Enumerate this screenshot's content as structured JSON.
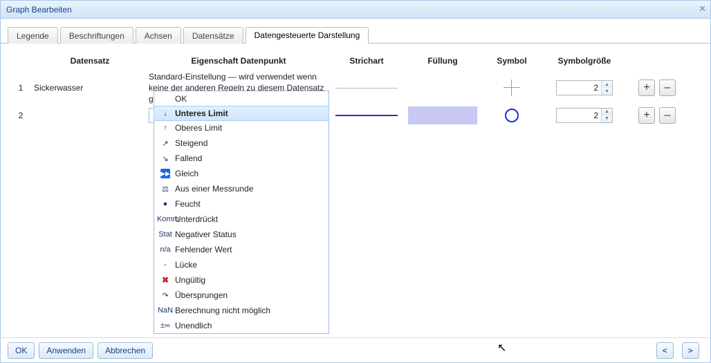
{
  "title": "Graph Bearbeiten",
  "tabs": [
    "Legende",
    "Beschriftungen",
    "Achsen",
    "Datensätze",
    "Datengesteuerte Darstellung"
  ],
  "active_tab": 4,
  "columns": {
    "idx": "",
    "ds": "Datensatz",
    "prop": "Eigenschaft Datenpunkt",
    "stroke": "Strichart",
    "fill": "Füllung",
    "symbol": "Symbol",
    "size": "Symbolgröße"
  },
  "rows": [
    {
      "idx": "1",
      "ds": "Sickerwasser",
      "prop": "Standard-Einstellung — wird verwendet wenn keine der anderen Regeln zu diesem Datensatz greift",
      "size": "2"
    },
    {
      "idx": "2",
      "ds": "",
      "prop": "Unteres Limit",
      "size": "2"
    }
  ],
  "dropdown": {
    "selected": 1,
    "items": [
      {
        "icon": "",
        "label": "OK"
      },
      {
        "icon": "↓",
        "label": "Unteres Limit"
      },
      {
        "icon": "↑",
        "label": "Oberes Limit"
      },
      {
        "icon": "↗",
        "label": "Steigend"
      },
      {
        "icon": "↘",
        "label": "Fallend"
      },
      {
        "icon": "gleich",
        "label": "Gleich"
      },
      {
        "icon": "⚖",
        "label": "Aus einer Messrunde"
      },
      {
        "icon": "●",
        "label": "Feucht"
      },
      {
        "icon": "Komm",
        "label": "Unterdrückt"
      },
      {
        "icon": "Stat",
        "label": "Negativer Status"
      },
      {
        "icon": "n/a",
        "label": "Fehlender Wert"
      },
      {
        "icon": "-",
        "label": "Lücke"
      },
      {
        "icon": "invalid",
        "label": "Ungültig"
      },
      {
        "icon": "↷",
        "label": "Übersprungen"
      },
      {
        "icon": "NaN",
        "label": "Berechnung nicht möglich"
      },
      {
        "icon": "±∞",
        "label": "Unendlich"
      }
    ]
  },
  "buttons": {
    "ok": "OK",
    "apply": "Anwenden",
    "cancel": "Abbrechen",
    "prev": "<",
    "next": ">",
    "add": "+",
    "remove": "–"
  }
}
